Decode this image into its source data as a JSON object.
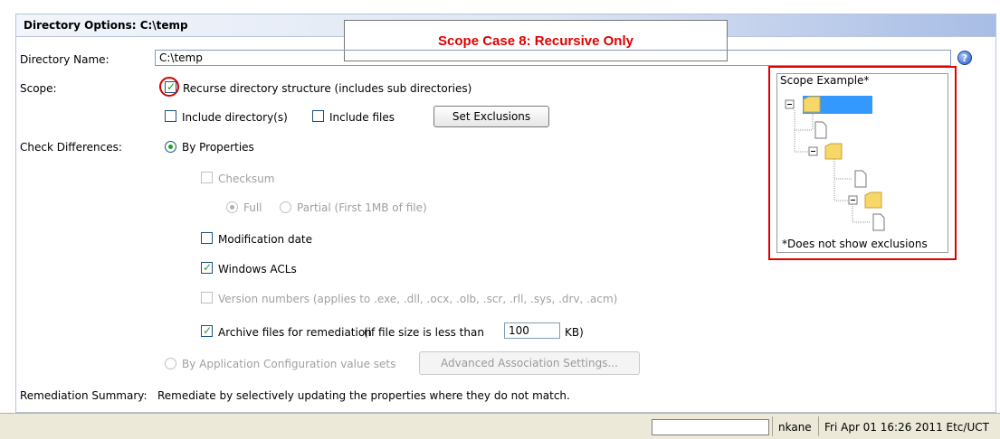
{
  "panel": {
    "title": "Directory Options: C:\\temp"
  },
  "callout": {
    "text": "Scope Case 8: Recursive Only",
    "color": "#e00000"
  },
  "directory": {
    "label": "Directory Name:",
    "value": "C:\\temp",
    "help_icon": "help-icon"
  },
  "scope": {
    "label": "Scope:",
    "recurse_label": "Recurse directory structure (includes sub directories)",
    "recurse_checked": true,
    "include_dirs_label": "Include directory(s)",
    "include_dirs_checked": false,
    "include_files_label": "Include files",
    "include_files_checked": false,
    "exclusions_button": "Set Exclusions"
  },
  "check_differences": {
    "label": "Check Differences:",
    "by_properties_label": "By Properties",
    "by_properties_selected": true,
    "checksum_label": "Checksum",
    "full_label": "Full",
    "partial_label": "Partial (First 1MB of file)",
    "modification_date_label": "Modification date",
    "windows_acls_label": "Windows ACLs",
    "windows_acls_checked": true,
    "version_numbers_label": "Version numbers (applies to .exe, .dll, .ocx, .olb, .scr, .rll, .sys, .drv, .acm)",
    "archive_label": "Archive files for remediation",
    "archive_checked": true,
    "archive_condition": "(if file size is less than",
    "archive_size": "100",
    "archive_unit": "KB)",
    "app_config_label": "By Application Configuration value sets",
    "advanced_button": "Advanced Association Settings..."
  },
  "remediation": {
    "label": "Remediation Summary:",
    "text": "Remediate by selectively updating the properties where they do not match."
  },
  "scope_example": {
    "title": "Scope Example*",
    "footnote": "*Does not show exclusions",
    "highlight_color": "#e00000"
  },
  "statusbar": {
    "user": "nkane",
    "datetime": "Fri Apr 01 16:26 2011 Etc/UCT"
  }
}
